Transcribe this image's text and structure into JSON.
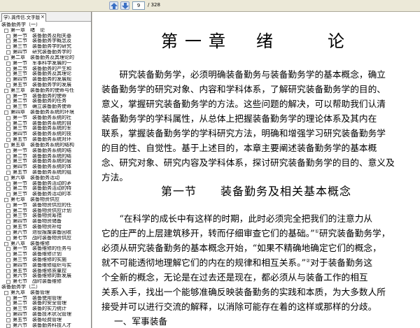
{
  "toolbar": {
    "prev_icon": "up-arrow-icon",
    "next_icon": "down-arrow-icon",
    "current_page": "9",
    "total_pages": "/ 328"
  },
  "panel": {
    "tab_label": "学).龚传信.文字版",
    "tab_close": "×",
    "tree": [
      {
        "indent": 0,
        "box": false,
        "text": "装备勤务学（一）"
      },
      {
        "indent": 1,
        "box": true,
        "text": "第一章　绪　论"
      },
      {
        "indent": 2,
        "box": true,
        "text": "第一节　装备勤务及相关基"
      },
      {
        "indent": 2,
        "box": true,
        "text": "第二节　装备勤务学概念及"
      },
      {
        "indent": 2,
        "box": true,
        "text": "第三节　装备勤务学的研究"
      },
      {
        "indent": 2,
        "box": true,
        "text": "第四节　研究装备勤务学的"
      },
      {
        "indent": 1,
        "box": true,
        "text": "第二章　装备勤务及其理论的"
      },
      {
        "indent": 2,
        "box": true,
        "text": "第一节　军事科学发展的一"
      },
      {
        "indent": 2,
        "box": true,
        "text": "第二节　装备勤务的产生和"
      },
      {
        "indent": 2,
        "box": true,
        "text": "第三节　装备勤务及其理论"
      },
      {
        "indent": 2,
        "box": true,
        "text": "第四节　装备勤务的发展规"
      },
      {
        "indent": 2,
        "box": true,
        "text": "第五节　装备勤务学的发展"
      },
      {
        "indent": 1,
        "box": true,
        "text": "第三章　装备勤务的使命与任"
      },
      {
        "indent": 2,
        "box": true,
        "text": "第一节　装备勤务的使命"
      },
      {
        "indent": 2,
        "box": true,
        "text": "第二节　装备勤务的任务"
      },
      {
        "indent": 2,
        "box": true,
        "text": "第三节　确立装备勤务使命"
      },
      {
        "indent": 1,
        "box": true,
        "text": "第四章　装备勤务系统的环境"
      },
      {
        "indent": 2,
        "box": true,
        "text": "第一节　装备勤务系统的社"
      },
      {
        "indent": 2,
        "box": true,
        "text": "第二节　装备勤务系统的自"
      },
      {
        "indent": 2,
        "box": true,
        "text": "第三节　装备勤务系统的军"
      },
      {
        "indent": 2,
        "box": true,
        "text": "第四节　装备勤务系统的技"
      },
      {
        "indent": 2,
        "box": true,
        "text": "第五节　装备勤务系统对环"
      },
      {
        "indent": 1,
        "box": true,
        "text": "第五章　装备勤务系统的结构"
      },
      {
        "indent": 2,
        "box": true,
        "text": "第一节　装备勤务系统的结"
      },
      {
        "indent": 2,
        "box": true,
        "text": "第二节　装备勤务系统的结"
      },
      {
        "indent": 2,
        "box": true,
        "text": "第三节　装备勤务系统的层"
      },
      {
        "indent": 2,
        "box": true,
        "text": "第四节　装备勤务系统的体"
      },
      {
        "indent": 2,
        "box": true,
        "text": "第五节　装备勤务系统的组"
      },
      {
        "indent": 1,
        "box": true,
        "text": "第六章　装备勤务活动"
      },
      {
        "indent": 2,
        "box": true,
        "text": "第一节　装备勤务活动的矛"
      },
      {
        "indent": 2,
        "box": true,
        "text": "第二节　装备勤务活动的特"
      },
      {
        "indent": 2,
        "box": true,
        "text": "第三节　装备勤务活动的本"
      },
      {
        "indent": 1,
        "box": true,
        "text": "第七章　装备物资供应"
      },
      {
        "indent": 2,
        "box": true,
        "text": "第一节　装备物资供应的任"
      },
      {
        "indent": 2,
        "box": true,
        "text": "第二节　装备物资供应计划"
      },
      {
        "indent": 2,
        "box": true,
        "text": "第三节　装备物资筹措"
      },
      {
        "indent": 2,
        "box": true,
        "text": "第四节　装备物资储备"
      },
      {
        "indent": 2,
        "box": true,
        "text": "第五节　装备物资补给"
      },
      {
        "indent": 2,
        "box": true,
        "text": "第六节　退役报废装备回收"
      },
      {
        "indent": 2,
        "box": true,
        "text": "第七节　战时装备物资供应"
      },
      {
        "indent": 1,
        "box": true,
        "text": "第八章　装备维修"
      },
      {
        "indent": 2,
        "box": true,
        "text": "第一节　装备维修的任务与"
      },
      {
        "indent": 2,
        "box": true,
        "text": "第二节　装备维修计划"
      },
      {
        "indent": 2,
        "box": true,
        "text": "第三节　装备维修的实施"
      },
      {
        "indent": 2,
        "box": true,
        "text": "第四节　装备维修组织与实"
      },
      {
        "indent": 2,
        "box": true,
        "text": "第五节　装备维修质量控"
      },
      {
        "indent": 2,
        "box": true,
        "text": "第六节　装备维修的新发展"
      },
      {
        "indent": 2,
        "box": true,
        "text": "第七节　战时装备维修"
      },
      {
        "indent": 0,
        "box": false,
        "text": "装备勤务学（二）"
      },
      {
        "indent": 1,
        "box": true,
        "text": "第九章　装备管理"
      },
      {
        "indent": 2,
        "box": true,
        "text": "第一节　装备使用管理"
      },
      {
        "indent": 2,
        "box": true,
        "text": "第二节　装备的安全管理"
      },
      {
        "indent": 2,
        "box": true,
        "text": "第三节　装备的实力统计"
      },
      {
        "indent": 2,
        "box": true,
        "text": "第四节　装备技术状况管理"
      },
      {
        "indent": 2,
        "box": true,
        "text": "第五节　装备经费管理"
      },
      {
        "indent": 2,
        "box": true,
        "text": "第六节　装备勤务科技人才"
      }
    ]
  },
  "doc": {
    "chapter_title": "第一章　绪　　论",
    "intro_lines": [
      "　　研究装备勤务学，必须明确装备勤务与装备勤务学的基本概念，确立",
      "装备勤务学的研究对象、内容和学科体系，了解研究装备勤务学的目的、",
      "意义，掌握研究装备勤务学的方法。这些问题的解决，可以帮助我们认清",
      "装备勤务学的学科属性，从总体上把握装备勤务学的理论体系及其内在",
      "联系，掌握装备勤务学的学科研究方法，明确和增强学习研究装备勤务学",
      "的目的性、自觉性。基于上述目的，本章主要阐述装备勤务学的基本概",
      "念、研究对象、研究内容及学科体系，探讨研究装备勤务学的目的、意义及",
      "方法。"
    ],
    "section_title": "第一节　　装备勤务及相关基本概念",
    "quote_lines": [
      "　　“在科学的成长中有这样的时期，此时必须完全把我们的注意力从",
      "它的庄严的上层建筑移开，转而仔细审查它们的基础。”",
      "必须从研究装备勤务的基本概念开始，“如果不精确地确定它们的概念，",
      "就不可能透彻地理解它们的内在的规律和相互关系。”",
      "个全新的概念，无论是在过去还是现在，都必须从与装备工作的相互",
      "关系入手，找出一个能够准确反映装备勤务的实践和本质，为大多数人所",
      "接受并可以进行交流的解释，以消除可能存在着的这样或那样的分歧。"
    ],
    "quote_line2_tail": "研究装备勤务学，",
    "quote_line4_tail": "对于装备勤务这",
    "footnote_1": "①",
    "footnote_2": "②",
    "sub_heading": "一、军事装备"
  }
}
